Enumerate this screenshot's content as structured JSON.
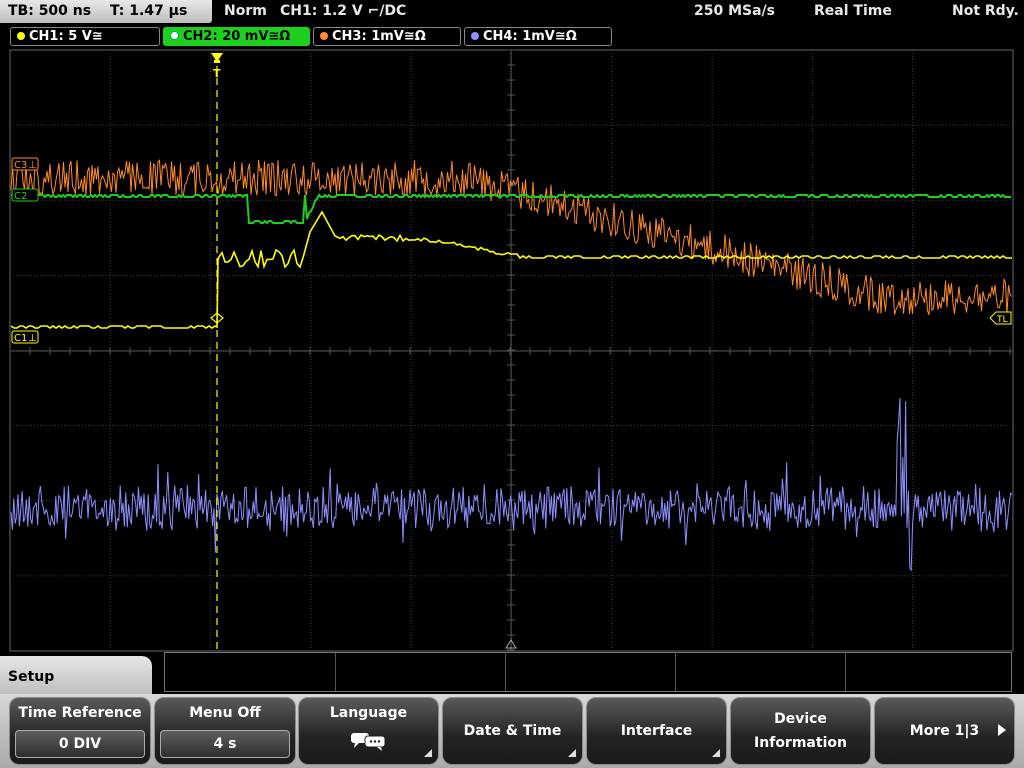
{
  "status": {
    "timebase": "TB: 500 ns",
    "trigger_time": "T: 1.47 µs",
    "mode": "Norm",
    "trigger_info": "CH1: 1.2 V ⌐/DC",
    "sample_rate": "250 MSa/s",
    "acq_mode": "Real Time",
    "state": "Not Rdy."
  },
  "channels": [
    {
      "label": "CH1: 5 V≅",
      "color": "#ffff00"
    },
    {
      "label": "CH2: 20 mV≅Ω",
      "color": "#1ed01e"
    },
    {
      "label": "CH3: 1mV≅Ω",
      "color": "#ff8a2a"
    },
    {
      "label": "CH4: 1mV≅Ω",
      "color": "#8f8fff"
    }
  ],
  "markers": {
    "ch3": "C3",
    "ch2": "C2",
    "ch1": "C1",
    "trigger_level": "TL",
    "trigger_pos": "T"
  },
  "menu": {
    "title": "Setup",
    "time_reference": {
      "label": "Time Reference",
      "value": "0 DIV"
    },
    "menu_off": {
      "label": "Menu Off",
      "value": "4 s"
    },
    "language": {
      "label": "Language",
      "icon": "speech-bubbles-icon"
    },
    "date_time": "Date & Time",
    "interface": "Interface",
    "device_info": [
      "Device",
      "Information"
    ],
    "more": "More 1|3"
  },
  "colors": {
    "ch1": "#ffff00",
    "ch2": "#1ed01e",
    "ch3": "#ff8a2a",
    "ch4": "#8f8fff",
    "grid": "#3c3c3c",
    "trigger_line": "#ffff00"
  }
}
